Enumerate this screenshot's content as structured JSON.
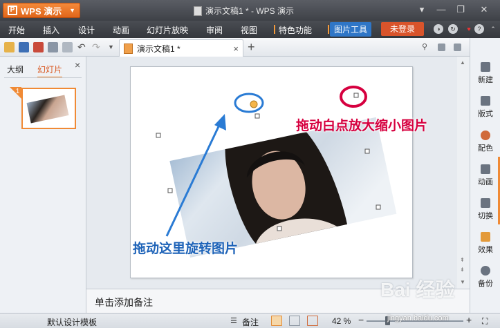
{
  "titlebar": {
    "app_label": "WPS 演示",
    "document_title": "演示文稿1 * - WPS 演示"
  },
  "menu": {
    "items": [
      "开始",
      "插入",
      "设计",
      "动画",
      "幻灯片放映",
      "审阅",
      "视图",
      "特色功能",
      "图片工具"
    ],
    "active": "图片工具",
    "login_label": "未登录"
  },
  "tab": {
    "label": "演示文稿1 *",
    "close": "×",
    "new": "+"
  },
  "left_panel": {
    "tabs": [
      "大纲",
      "幻灯片"
    ],
    "active_tab": "幻灯片",
    "close": "×",
    "slide_number": "1"
  },
  "annotations": {
    "resize_hint": "拖动白点放大缩小图片",
    "rotate_hint": "拖动这里旋转图片",
    "resize_color": "#d6003f",
    "rotate_color": "#2a7bd4"
  },
  "right_panel": {
    "items": [
      "新建",
      "版式",
      "配色",
      "动画",
      "切换",
      "效果",
      "备份"
    ]
  },
  "notes": {
    "placeholder": "单击添加备注"
  },
  "statusbar": {
    "template": "默认设计模板",
    "notes_label": "备注",
    "zoom": "42 %",
    "zoom_value": 42
  },
  "watermark": {
    "brand": "Bai 经验",
    "url": "jingyan.baidu.com"
  }
}
